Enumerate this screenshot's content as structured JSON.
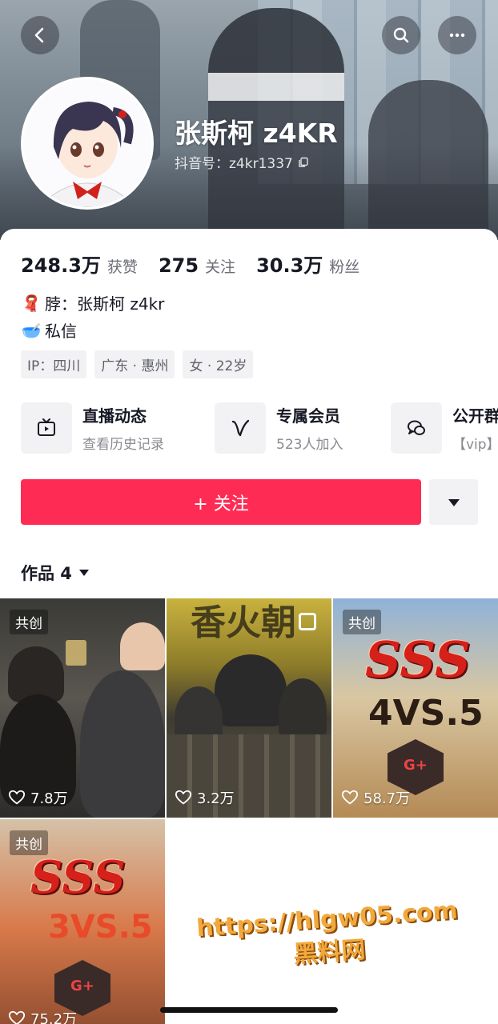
{
  "profile": {
    "name": "张斯柯 z4KR",
    "douyin_id": "抖音号：z4kr1337"
  },
  "stats": [
    {
      "num": "248.3万",
      "label": "获赞"
    },
    {
      "num": "275",
      "label": "关注"
    },
    {
      "num": "30.3万",
      "label": "粉丝"
    }
  ],
  "bio": {
    "line1_emoji": "🧣",
    "line1": "脖：张斯柯 z4kr",
    "line2_emoji": "🥣",
    "line2": "私信"
  },
  "tags": [
    "IP：四川",
    "广东 · 惠州",
    "女 · 22岁"
  ],
  "features": [
    {
      "icon": "tv-play-icon",
      "title": "直播动态",
      "sub": "查看历史记录"
    },
    {
      "icon": "vip-v-icon",
      "title": "专属会员",
      "sub": "523人加入"
    },
    {
      "icon": "group-chat-icon",
      "title": "公开群",
      "sub": "【vip】"
    }
  ],
  "follow_button": "+ 关注",
  "works": {
    "title": "作品 4"
  },
  "tiles": [
    {
      "badge": "共创",
      "likes": "7.8万"
    },
    {
      "badge": "",
      "likes": "3.2万"
    },
    {
      "badge": "共创",
      "likes": "58.7万"
    },
    {
      "badge": "共创",
      "likes": "75.2万"
    }
  ],
  "tile_art": {
    "sss": "SSS",
    "vs3": "4VS.5",
    "vs4": "3VS.5",
    "team_banner": "香火朝",
    "hex_label": "G+"
  },
  "watermark": {
    "line1": "https://hlgw05.com",
    "line2": "黑料网"
  },
  "colors": {
    "accent": "#fe2c55",
    "text": "#161823",
    "muted": "#6b6d75"
  }
}
